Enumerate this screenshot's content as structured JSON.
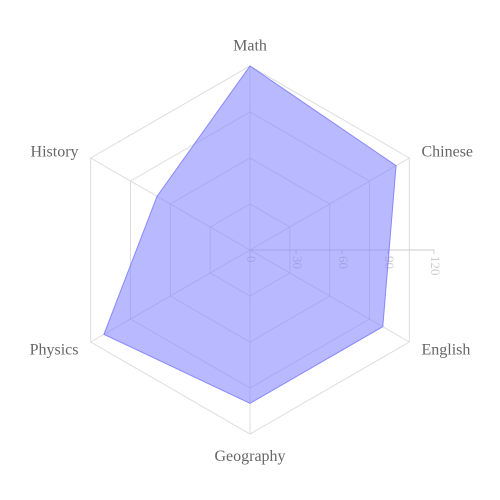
{
  "chart_data": {
    "type": "radar",
    "categories": [
      "Math",
      "Chinese",
      "English",
      "Geography",
      "Physics",
      "History"
    ],
    "series": [
      {
        "values": [
          120,
          110,
          100,
          100,
          110,
          70
        ],
        "color": "#8080ff"
      }
    ],
    "rlim": [
      0,
      120
    ],
    "ticks": [
      "0",
      "30",
      "60",
      "90",
      "120"
    ],
    "tick_values": [
      0,
      30,
      60,
      90,
      120
    ],
    "grid_color": "#dddddd",
    "label_color": "#666666",
    "tick_color": "#cccccc"
  }
}
